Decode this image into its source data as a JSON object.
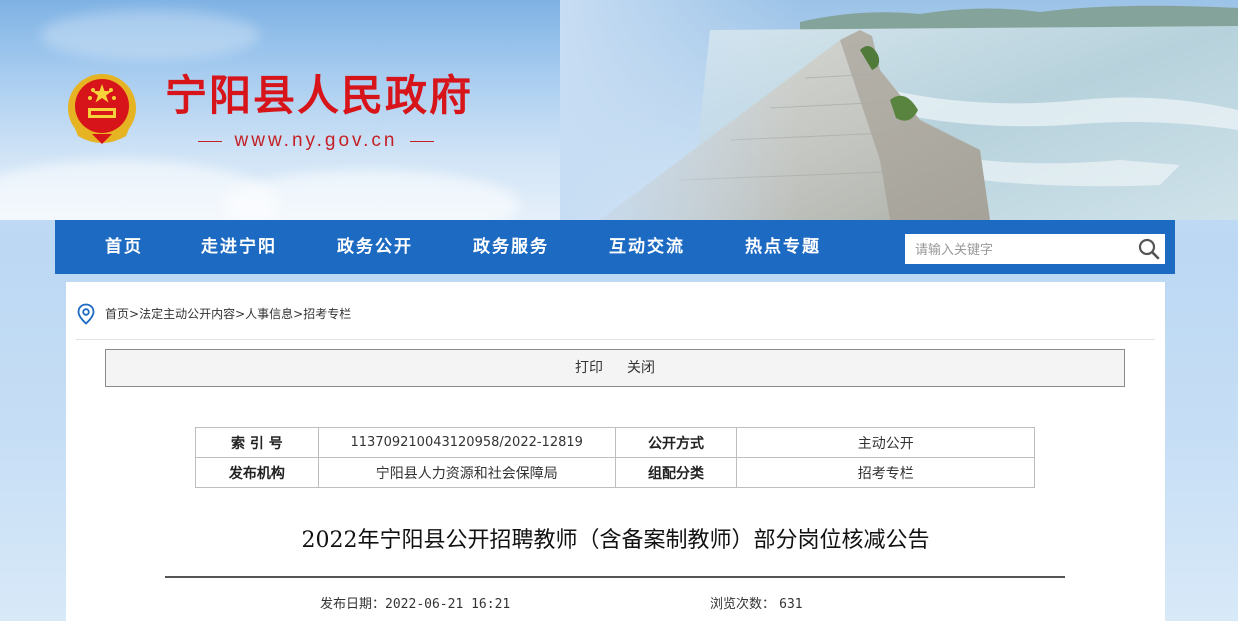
{
  "header": {
    "site_title": "宁阳县人民政府",
    "site_url": "www.ny.gov.cn"
  },
  "nav": {
    "items": [
      {
        "label": "首页"
      },
      {
        "label": "走进宁阳"
      },
      {
        "label": "政务公开"
      },
      {
        "label": "政务服务"
      },
      {
        "label": "互动交流"
      },
      {
        "label": "热点专题"
      }
    ],
    "search_placeholder": "请输入关键字"
  },
  "breadcrumb": {
    "items": [
      "首页",
      "法定主动公开内容",
      "人事信息",
      "招考专栏"
    ],
    "separator": ">"
  },
  "toolbar": {
    "print_label": "打印",
    "close_label": "关闭"
  },
  "meta": {
    "index_label": "索 引 号",
    "index_value": "113709210043120958/2022-12819",
    "open_mode_label": "公开方式",
    "open_mode_value": "主动公开",
    "publisher_label": "发布机构",
    "publisher_value": "宁阳县人力资源和社会保障局",
    "category_label": "组配分类",
    "category_value": "招考专栏"
  },
  "article": {
    "title": "2022年宁阳县公开招聘教师（含备案制教师）部分岗位核减公告",
    "date_label": "发布日期：",
    "date_value": "2022-06-21 16:21",
    "views_label": "浏览次数：",
    "views_value": "631"
  },
  "colors": {
    "nav_bg": "#1d6ac2",
    "title_red": "#d7141a"
  }
}
